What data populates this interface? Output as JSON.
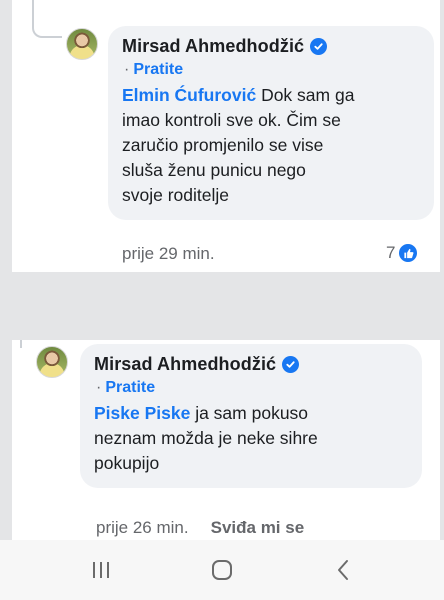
{
  "comments": [
    {
      "author": "Mirsad Ahmedhodžić",
      "follow_label": "Pratite",
      "mention": "Elmin Ćufurović",
      "text": "Dok sam ga\nimao kontroli sve ok. Čim se\nzaručio  promjenilo se vise\nsluša ženu punicu nego\nsvoje roditelje",
      "time": "prije 29 min.",
      "like_count": "7"
    },
    {
      "author": "Mirsad Ahmedhodžić",
      "follow_label": "Pratite",
      "mention": "Piske Piske",
      "text": "ja sam pokuso\nneznam možda je neke sihre\npokupijo",
      "time": "prije 26 min.",
      "like_action": "Sviđa mi se"
    }
  ],
  "colors": {
    "accent": "#1877f2",
    "bubble": "#f0f2f5",
    "meta": "#65676b"
  },
  "icons": [
    "verified-badge-icon",
    "like-icon",
    "recent-apps-icon",
    "home-icon",
    "back-icon"
  ]
}
